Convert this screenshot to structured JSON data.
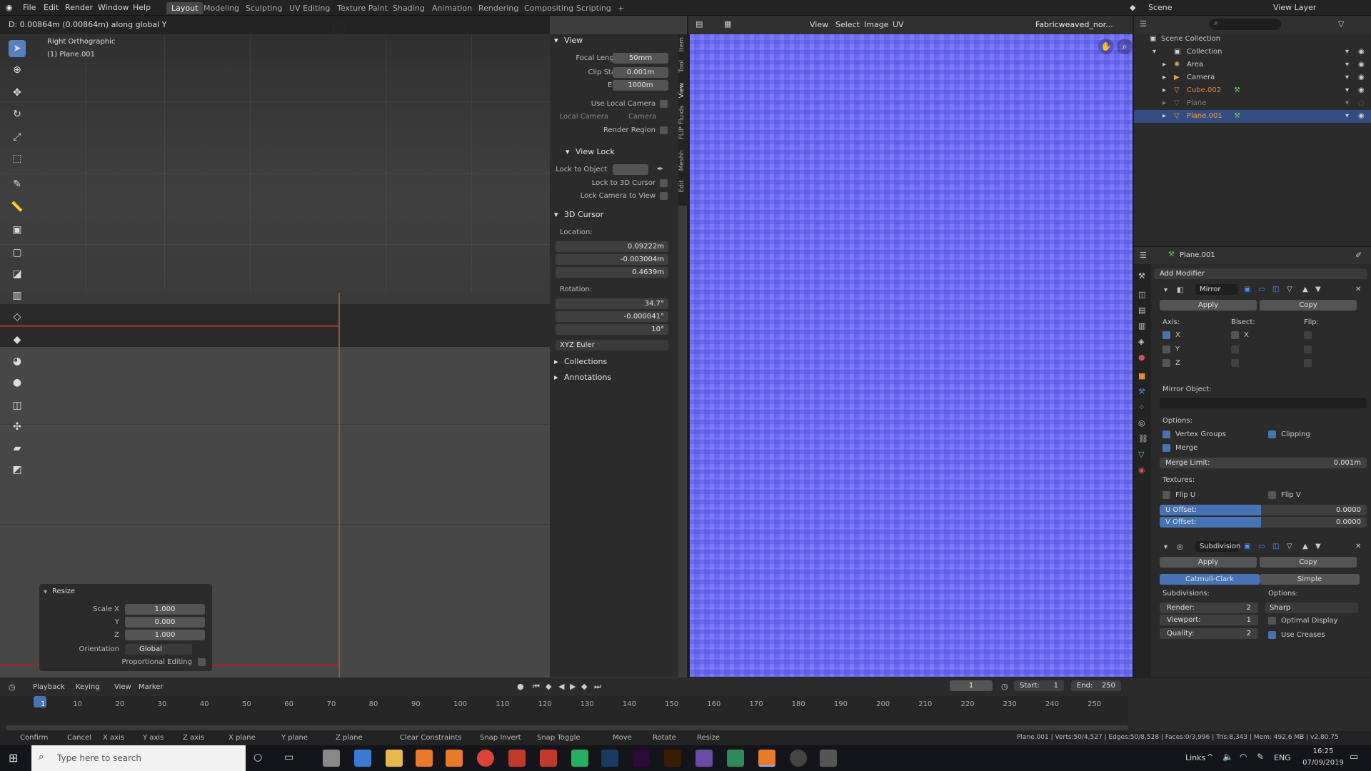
{
  "topbar": {
    "menus": [
      "File",
      "Edit",
      "Render",
      "Window",
      "Help"
    ],
    "workspaces": [
      "Layout",
      "Modeling",
      "Sculpting",
      "UV Editing",
      "Texture Paint",
      "Shading",
      "Animation",
      "Rendering",
      "Compositing",
      "Scripting",
      "+"
    ],
    "active_workspace": "Layout",
    "scene": "Scene",
    "view_layer": "View Layer"
  },
  "viewport": {
    "header_text": "D: 0.00864m (0.00864m) along global Y",
    "view_name": "Right Orthographic",
    "object_name": "(1) Plane.001"
  },
  "npanel": {
    "view_title": "View",
    "focal_length_label": "Focal Length",
    "focal_length": "50mm",
    "clip_start_label": "Clip Start",
    "clip_start": "0.001m",
    "end_label": "End",
    "end": "1000m",
    "use_local_camera": "Use Local Camera",
    "local_camera_label": "Local Camera",
    "local_camera_value": "Camera",
    "render_region": "Render Region",
    "view_lock_title": "View Lock",
    "lock_to_object": "Lock to Object",
    "lock_to_3d_cursor": "Lock to 3D Cursor",
    "lock_camera_to_view": "Lock Camera to View",
    "cursor_title": "3D Cursor",
    "location_label": "Location:",
    "loc_x": "0.09222m",
    "loc_y": "-0.003004m",
    "loc_z": "0.4639m",
    "rotation_label": "Rotation:",
    "rot_x": "34.7°",
    "rot_y": "-0.000041°",
    "rot_z": "10°",
    "rotation_mode": "XYZ Euler",
    "collections": "Collections",
    "annotations": "Annotations",
    "tabs": [
      "Item",
      "Tool",
      "View",
      "FLIP Fluids",
      "Meshh",
      "Edit"
    ]
  },
  "resize_panel": {
    "title": "Resize",
    "scale_x_label": "Scale X",
    "scale_x": "1.000",
    "y_label": "Y",
    "y": "0.000",
    "z_label": "Z",
    "z": "1.000",
    "orientation_label": "Orientation",
    "orientation": "Global",
    "proportional_editing": "Proportional Editing"
  },
  "image_editor": {
    "menus": [
      "View",
      "Select",
      "Image",
      "UV"
    ],
    "image_name": "Fabricweaved_nor...",
    "texture_color": "#6b6bf2"
  },
  "outliner": {
    "root": "Scene Collection",
    "collection": "Collection",
    "items": [
      {
        "name": "Area",
        "color": "#cccccc"
      },
      {
        "name": "Camera",
        "color": "#cccccc"
      },
      {
        "name": "Cube.002",
        "color": "#e08a3a"
      },
      {
        "name": "Plane",
        "color": "#7a6a5a"
      },
      {
        "name": "Plane.001",
        "color": "#e08a3a"
      }
    ]
  },
  "properties": {
    "object_name": "Plane.001",
    "add_modifier": "Add Modifier",
    "mirror": {
      "name": "Mirror",
      "apply": "Apply",
      "copy": "Copy",
      "axis_label": "Axis:",
      "bisect_label": "Bisect:",
      "flip_label": "Flip:",
      "x": "X",
      "y": "Y",
      "z": "Z",
      "mirror_object_label": "Mirror Object:",
      "options_label": "Options:",
      "vertex_groups": "Vertex Groups",
      "clipping": "Clipping",
      "merge": "Merge",
      "merge_limit_label": "Merge Limit:",
      "merge_limit": "0.001m",
      "textures_label": "Textures:",
      "flip_u": "Flip U",
      "flip_v": "Flip V",
      "u_offset_label": "U Offset:",
      "u_offset": "0.0000",
      "v_offset_label": "V Offset:",
      "v_offset": "0.0000"
    },
    "subdivision": {
      "name": "Subdivision",
      "apply": "Apply",
      "copy": "Copy",
      "catmull": "Catmull-Clark",
      "simple": "Simple",
      "subdivisions_label": "Subdivisions:",
      "options_label": "Options:",
      "render_label": "Render:",
      "render": "2",
      "viewport_label": "Viewport:",
      "viewport": "1",
      "quality_label": "Quality:",
      "quality": "2",
      "sharp": "Sharp",
      "optimal_display": "Optimal Display",
      "use_creases": "Use Creases"
    }
  },
  "timeline": {
    "menus": [
      "Playback",
      "Keying",
      "View",
      "Marker"
    ],
    "current_frame": "1",
    "start_label": "Start:",
    "start": "1",
    "end_label": "End:",
    "end": "250",
    "ticks": [
      "1",
      "10",
      "20",
      "30",
      "40",
      "50",
      "60",
      "70",
      "80",
      "90",
      "100",
      "110",
      "120",
      "130",
      "140",
      "150",
      "160",
      "170",
      "180",
      "190",
      "200",
      "210",
      "220",
      "230",
      "240",
      "250"
    ]
  },
  "statusbar": {
    "items": [
      "Confirm",
      "Cancel",
      "X axis",
      "Y axis",
      "Z axis",
      "X plane",
      "Y plane",
      "Z plane",
      "Clear Constraints",
      "Snap Invert",
      "Snap Toggle",
      "Move",
      "Rotate",
      "Resize"
    ],
    "stats": "Plane.001 | Verts:50/4,527 | Edges:50/8,528 | Faces:0/3,996 | Tris:8,343 | Mem: 492.6 MB | v2.80.75"
  },
  "taskbar": {
    "search_placeholder": "Type here to search",
    "links": "Links",
    "lang": "ENG",
    "time": "16:25",
    "date": "07/09/2019"
  }
}
